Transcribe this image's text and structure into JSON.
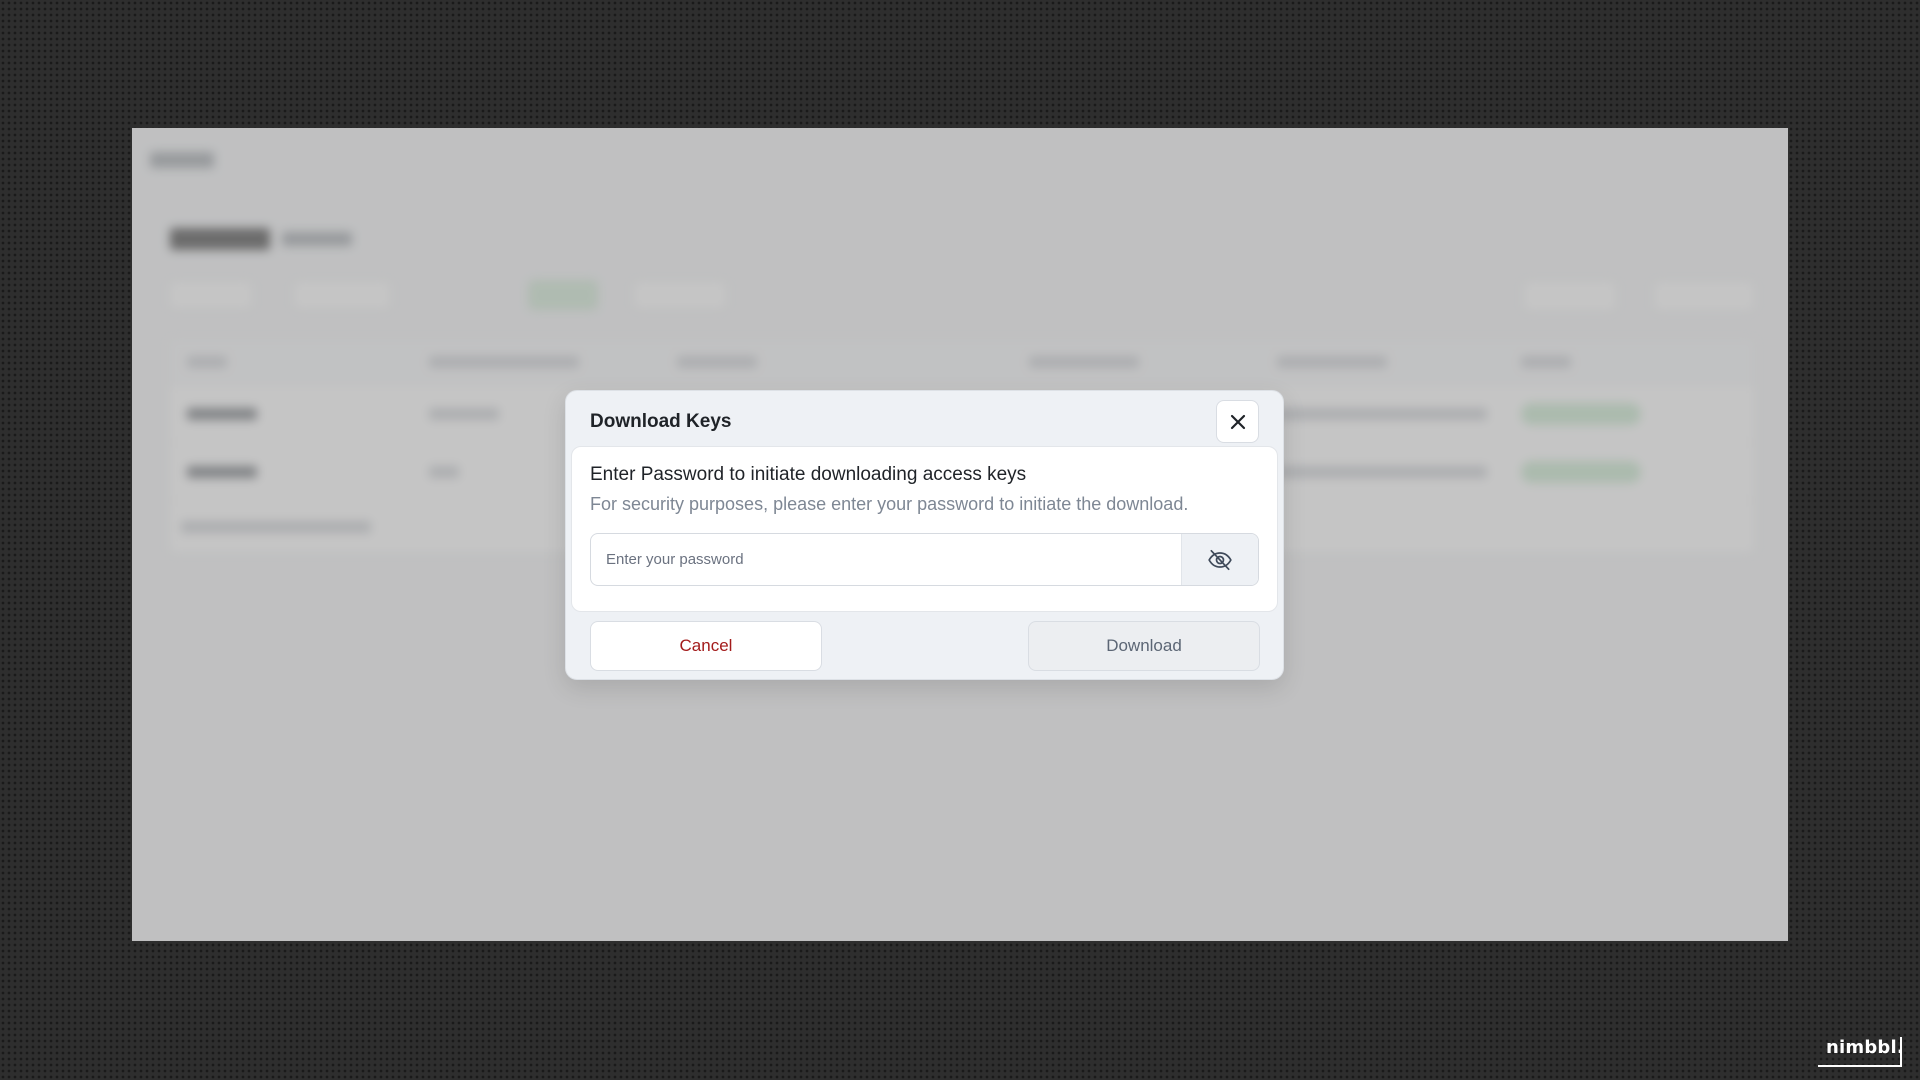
{
  "modal": {
    "title": "Download Keys",
    "heading": "Enter Password to initiate downloading access keys",
    "description": "For security purposes, please enter your password to initiate the download.",
    "password_value": "",
    "password_placeholder": "Enter your password",
    "cancel_label": "Cancel",
    "download_label": "Download"
  },
  "icons": {
    "close": "close-icon",
    "toggle_visibility": "eye-off-icon"
  },
  "brand": {
    "name": "nimbbl."
  },
  "colors": {
    "cancel_text": "#a31b1b",
    "download_text": "#5c6675",
    "modal_bg": "#eef1f5",
    "backdrop": "#2e2e2e"
  }
}
